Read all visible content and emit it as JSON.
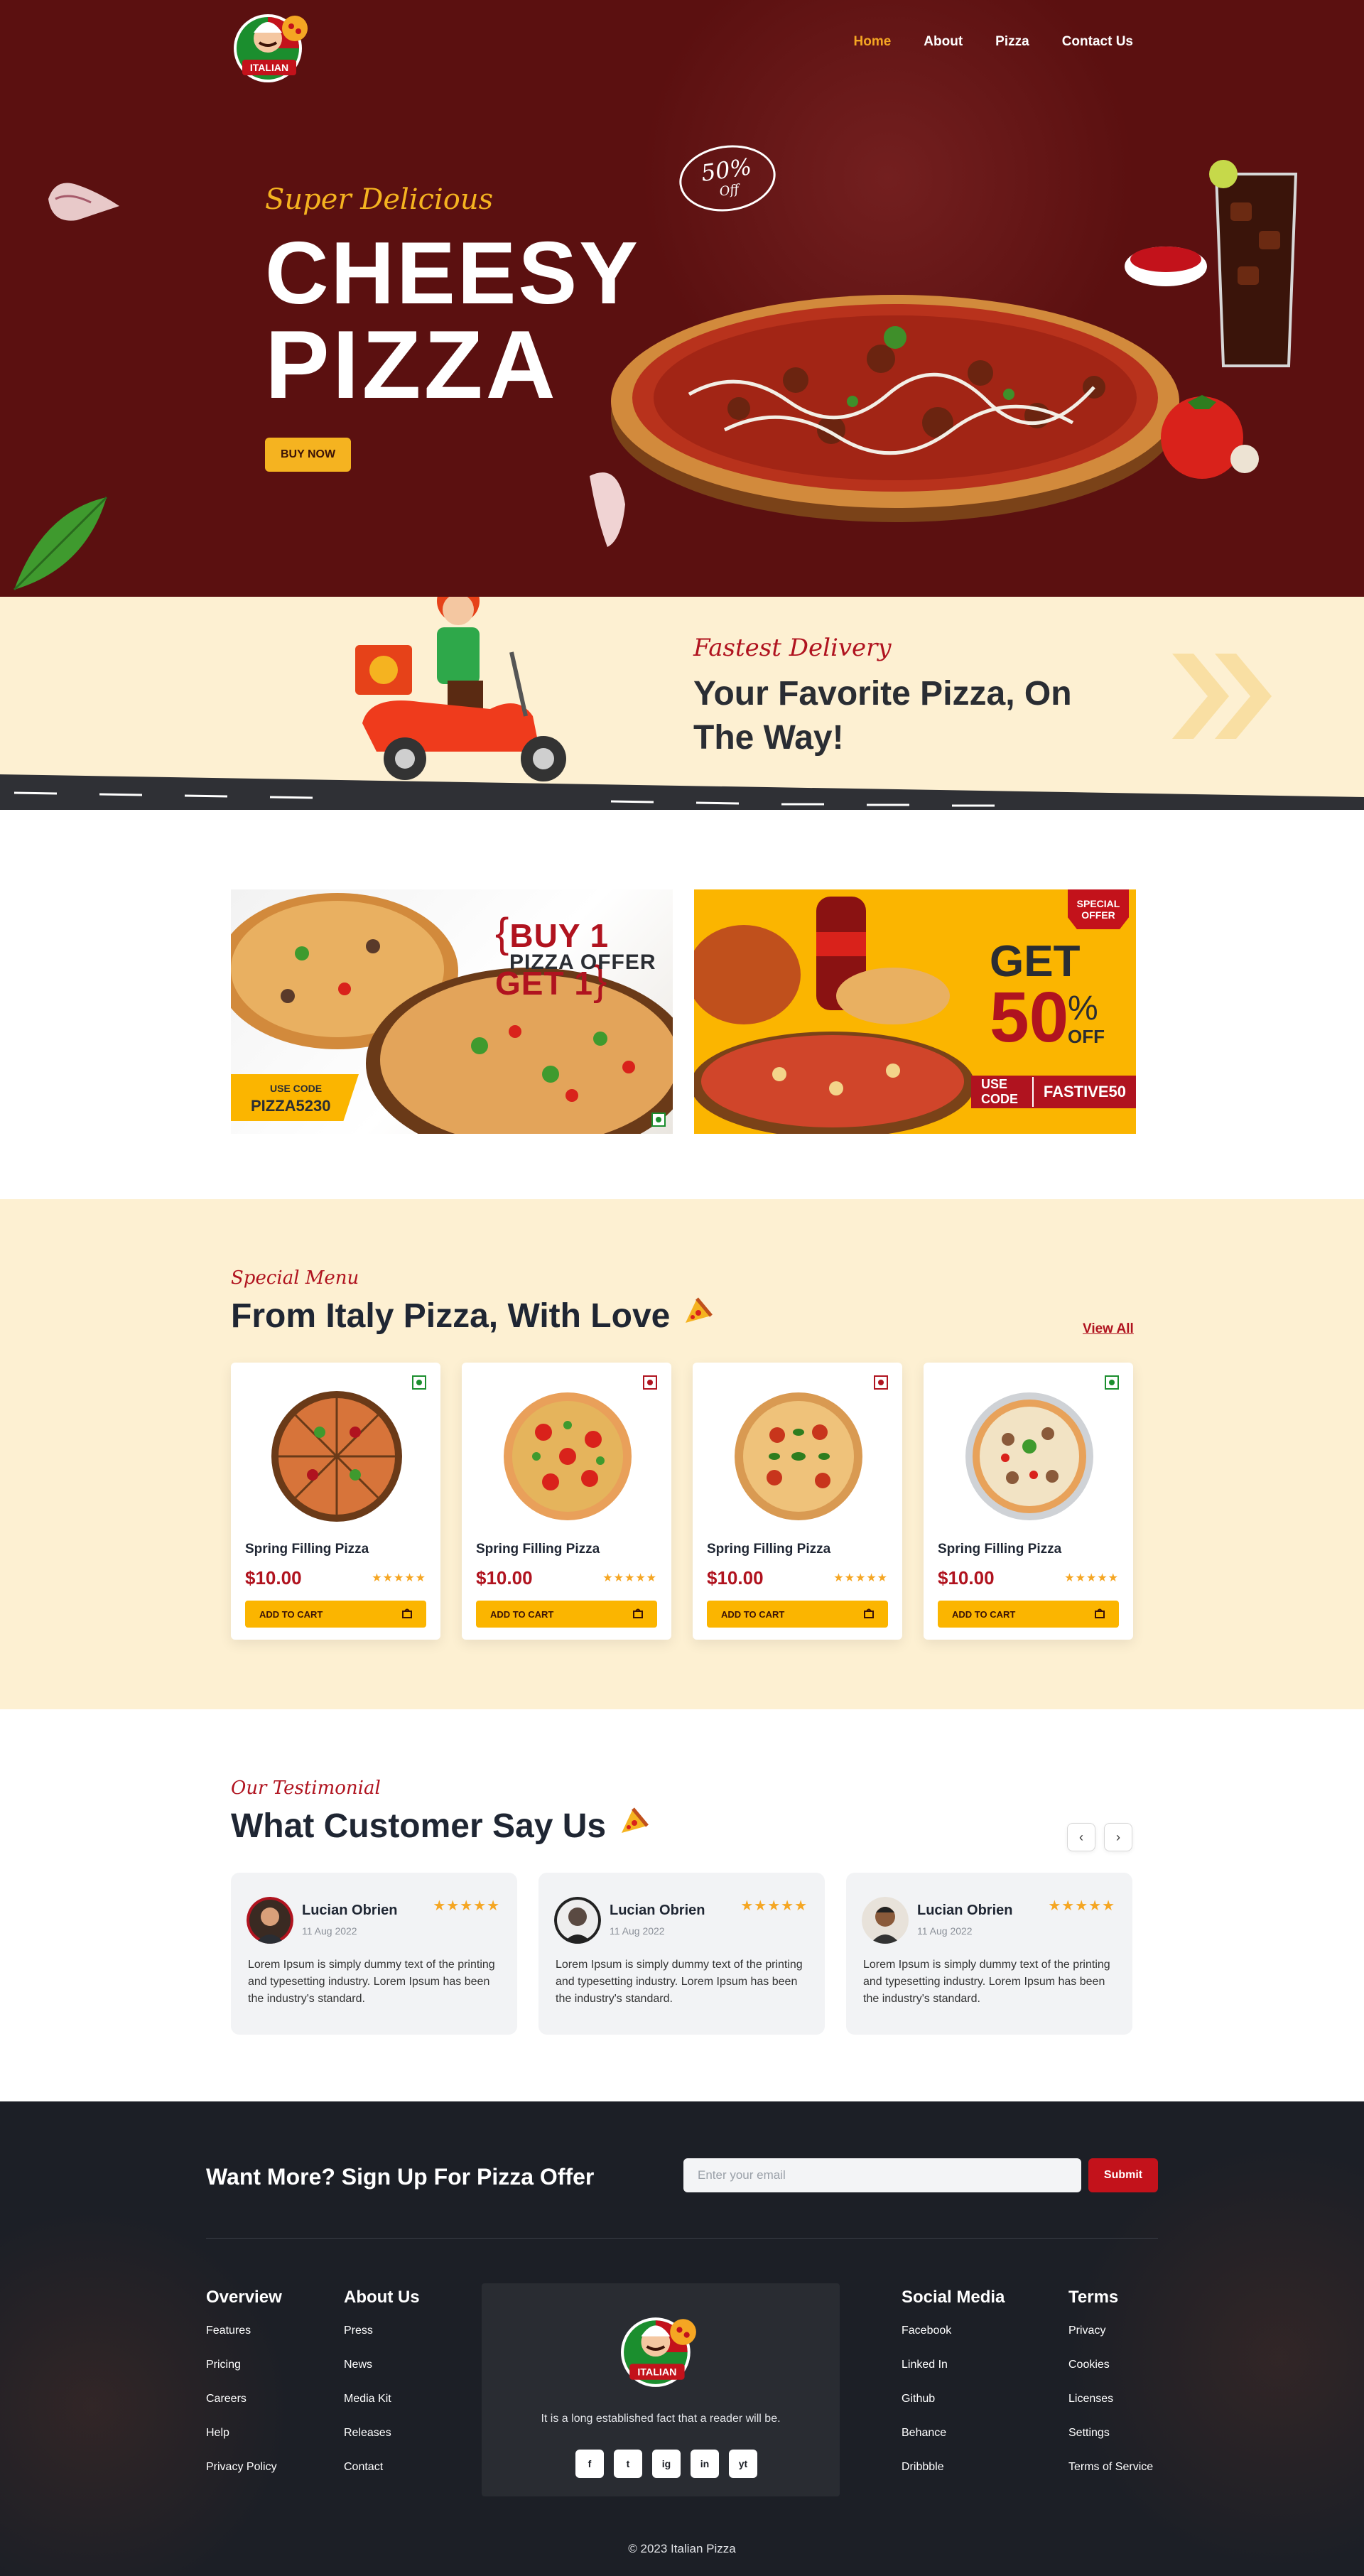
{
  "nav": {
    "links": [
      {
        "label": "Home",
        "active": true
      },
      {
        "label": "About",
        "active": false
      },
      {
        "label": "Pizza",
        "active": false
      },
      {
        "label": "Contact Us",
        "active": false
      }
    ],
    "logo_text": "ITALIAN PIZZA"
  },
  "hero": {
    "kicker": "Super Delicious",
    "title_line1": "CHEESY",
    "title_line2": "PIZZA",
    "button": "BUY NOW",
    "offer_percent": "50%",
    "offer_label": "Off"
  },
  "delivery": {
    "kicker": "Fastest Delivery",
    "title": "Your Favorite Pizza, On The Way!"
  },
  "offers": {
    "card1": {
      "title": "BUY 1 GET 1",
      "subtitle": "PIZZA OFFER",
      "code_label": "USE CODE",
      "code": "PIZZA5230"
    },
    "card2": {
      "badge_line1": "SPECIAL",
      "badge_line2": "OFFER",
      "get": "GET",
      "percent": "50",
      "percent_sign": "%",
      "off": "OFF",
      "code_label": "USE CODE",
      "code": "FASTIVE50"
    }
  },
  "menu": {
    "kicker": "Special Menu",
    "title": "From Italy Pizza, With Love",
    "view_all": "View All",
    "items": [
      {
        "name": "Spring Filling Pizza",
        "price": "$10.00",
        "stars": "★★★★★",
        "button": "ADD TO CART",
        "veg": true
      },
      {
        "name": "Spring Filling Pizza",
        "price": "$10.00",
        "stars": "★★★★★",
        "button": "ADD TO CART",
        "veg": false
      },
      {
        "name": "Spring Filling Pizza",
        "price": "$10.00",
        "stars": "★★★★★",
        "button": "ADD TO CART",
        "veg": false
      },
      {
        "name": "Spring Filling Pizza",
        "price": "$10.00",
        "stars": "★★★★★",
        "button": "ADD TO CART",
        "veg": true
      }
    ]
  },
  "testimonials": {
    "kicker": "Our Testimonial",
    "title": "What Customer Say Us",
    "prev_icon": "‹",
    "next_icon": "›",
    "items": [
      {
        "name": "Lucian Obrien",
        "date": "11 Aug 2022",
        "stars": "★★★★★",
        "text": "Lorem Ipsum is simply dummy text of the printing and typesetting industry. Lorem Ipsum has been the industry's standard."
      },
      {
        "name": "Lucian Obrien",
        "date": "11 Aug 2022",
        "stars": "★★★★★",
        "text": "Lorem Ipsum is simply dummy text of the printing and typesetting industry. Lorem Ipsum has been the industry's standard."
      },
      {
        "name": "Lucian Obrien",
        "date": "11 Aug 2022",
        "stars": "★★★★★",
        "text": "Lorem Ipsum is simply dummy text of the printing and typesetting industry. Lorem Ipsum has been the industry's standard."
      }
    ]
  },
  "footer": {
    "signup_title": "Want More? Sign Up For Pizza Offer",
    "email_placeholder": "Enter your email",
    "submit": "Submit",
    "overview": {
      "title": "Overview",
      "links": [
        "Features",
        "Pricing",
        "Careers",
        "Help",
        "Privacy Policy"
      ]
    },
    "about": {
      "title": "About Us",
      "links": [
        "Press",
        "News",
        "Media Kit",
        "Releases",
        "Contact"
      ]
    },
    "center_text": "It is a long established fact that a reader will be.",
    "social": {
      "title": "Social Media",
      "links": [
        "Facebook",
        "Linked In",
        "Github",
        "Behance",
        "Dribbble"
      ]
    },
    "terms": {
      "title": "Terms",
      "links": [
        "Privacy",
        "Cookies",
        "Licenses",
        "Settings",
        "Terms of Service"
      ]
    },
    "social_icons": [
      "f",
      "t",
      "ig",
      "in",
      "yt"
    ],
    "copyright": "© 2023 Italian Pizza"
  },
  "colors": {
    "hero_bg": "#5b1010",
    "accent": "#f5b320",
    "brand_red": "#b0131f",
    "cream": "#fdf0d2",
    "footer_bg": "#1c1f26"
  }
}
